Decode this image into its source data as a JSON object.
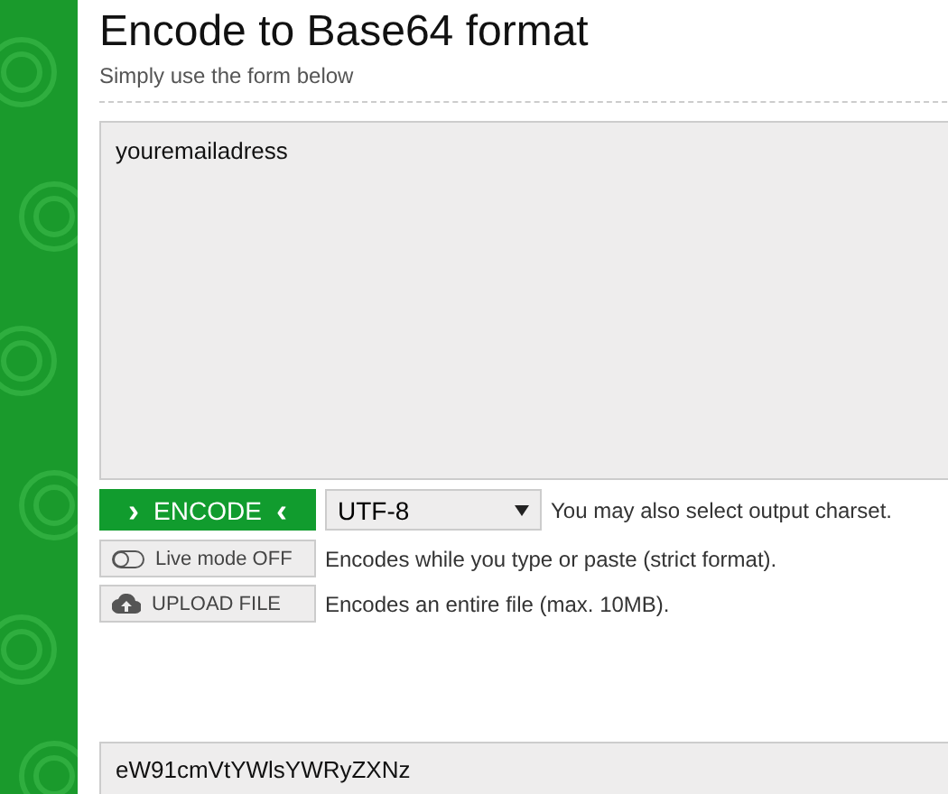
{
  "header": {
    "title": "Encode to Base64 format",
    "subtitle": "Simply use the form below"
  },
  "input": {
    "value": "youremailadress"
  },
  "encode_button": {
    "label": "ENCODE",
    "left_chevron": "›",
    "right_chevron": "‹"
  },
  "charset": {
    "value": "UTF-8",
    "hint": "You may also select output charset."
  },
  "live_mode": {
    "label": "Live mode OFF",
    "on": false,
    "hint": "Encodes while you type or paste (strict format)."
  },
  "upload": {
    "label": "UPLOAD FILE",
    "hint": "Encodes an entire file (max. 10MB)."
  },
  "output": {
    "value": "eW91cmVtYWlsYWRyZXNz"
  }
}
